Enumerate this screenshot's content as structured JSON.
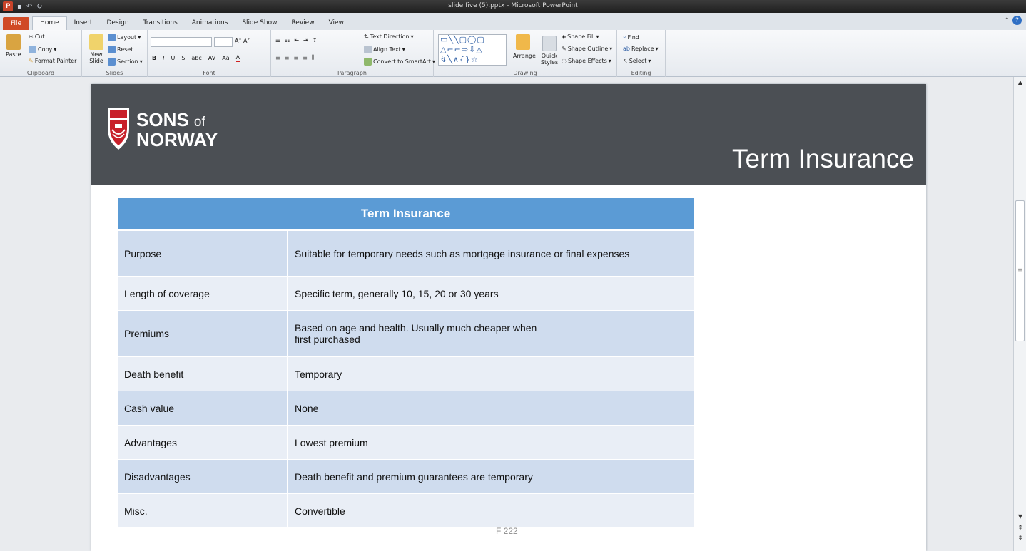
{
  "window": {
    "title": "slide five (5).pptx - Microsoft PowerPoint",
    "app_badge": "P"
  },
  "ribbon": {
    "tabs": [
      "File",
      "Home",
      "Insert",
      "Design",
      "Transitions",
      "Animations",
      "Slide Show",
      "Review",
      "View"
    ],
    "active_tab": "Home",
    "clipboard": {
      "paste": "Paste",
      "cut": "Cut",
      "copy": "Copy",
      "format_painter": "Format Painter",
      "group": "Clipboard"
    },
    "slides": {
      "new_slide": "New Slide",
      "layout": "Layout",
      "reset": "Reset",
      "section": "Section",
      "group": "Slides"
    },
    "font": {
      "group": "Font",
      "format_buttons": [
        "B",
        "I",
        "U",
        "S",
        "abc",
        "AV",
        "Aa",
        "A"
      ]
    },
    "paragraph": {
      "text_direction": "Text Direction",
      "align_text": "Align Text",
      "convert_smartart": "Convert to SmartArt",
      "group": "Paragraph"
    },
    "drawing": {
      "arrange": "Arrange",
      "quick_styles": "Quick Styles",
      "shape_fill": "Shape Fill",
      "shape_outline": "Shape Outline",
      "shape_effects": "Shape Effects",
      "group": "Drawing"
    },
    "editing": {
      "find": "Find",
      "replace": "Replace",
      "select": "Select",
      "group": "Editing"
    }
  },
  "slide": {
    "logo": {
      "line1": "SONS",
      "of": "of",
      "line2": "NORWAY"
    },
    "title": "Term Insurance",
    "table": {
      "header": "Term Insurance",
      "rows": [
        {
          "label": "Purpose",
          "value": "Suitable for temporary needs such as mortgage insurance or final expenses"
        },
        {
          "label": "Length of coverage",
          "value": "Specific term, generally 10, 15, 20 or 30 years"
        },
        {
          "label": "Premiums",
          "value": "Based on age and health. Usually much cheaper when",
          "value2": "first purchased"
        },
        {
          "label": "Death benefit",
          "value": "Temporary"
        },
        {
          "label": "Cash value",
          "value": "None"
        },
        {
          "label": "Advantages",
          "value": "Lowest premium"
        },
        {
          "label": "Disadvantages",
          "value": "Death benefit and premium guarantees are temporary"
        },
        {
          "label": "Misc.",
          "value": "Convertible"
        }
      ]
    },
    "footer": "F 222"
  },
  "colors": {
    "banner": "#4b4f54",
    "table_header": "#5b9bd5",
    "row_odd": "#cfdcee",
    "row_even": "#e9eef6",
    "file_tab": "#d04a26"
  }
}
